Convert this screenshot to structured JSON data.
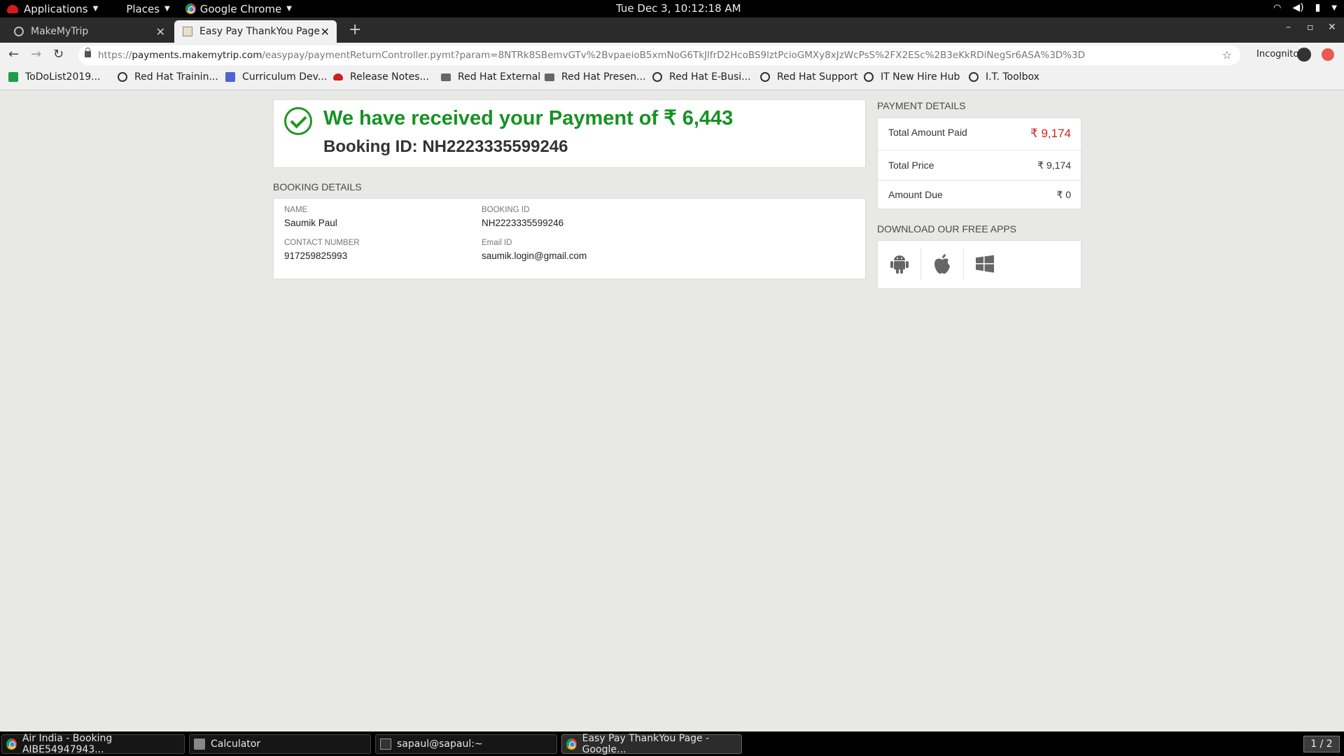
{
  "topbar": {
    "applications": "Applications",
    "places": "Places",
    "app": "Google Chrome",
    "clock": "Tue Dec  3, 10:12:18 AM",
    "tray": [
      "wifi-icon",
      "volume-icon",
      "battery-icon",
      "power-icon"
    ]
  },
  "tabs": [
    {
      "title": "MakeMyTrip",
      "icon": "globe-icon"
    },
    {
      "title": "Easy Pay ThankYou Page",
      "icon": "page-icon"
    }
  ],
  "omnibox": {
    "url_scheme": "https://",
    "url_host": "payments.makemytrip.com",
    "url_path": "/easypay/paymentReturnController.pymt?param=8NTRk8SBemvGTv%2BvpaeioB5xmNoG6TkJlfrD2HcoBS9lztPcioGMXy8xJzWcPsS%2FX2ESc%2B3eKkRDiNegSr6ASA%3D%3D"
  },
  "incognito_label": "Incognito",
  "bookmarks": [
    {
      "label": "ToDoList2019...",
      "icon": "green"
    },
    {
      "label": "Red Hat Trainin...",
      "icon": "globe"
    },
    {
      "label": "Curriculum Dev...",
      "icon": "doc"
    },
    {
      "label": "Release Notes...",
      "icon": "redhat"
    },
    {
      "label": "Red Hat External",
      "icon": "folder"
    },
    {
      "label": "Red Hat Presen...",
      "icon": "folder"
    },
    {
      "label": "Red Hat E-Busi...",
      "icon": "globe"
    },
    {
      "label": "Red Hat Support",
      "icon": "globe"
    },
    {
      "label": "IT New Hire Hub",
      "icon": "globe"
    },
    {
      "label": "I.T. Toolbox",
      "icon": "globe"
    }
  ],
  "payment": {
    "title": "We have received your Payment of ₹ 6,443",
    "booking_line": "Booking ID: NH2223335599246"
  },
  "booking_details": {
    "heading": "BOOKING DETAILS",
    "name_label": "NAME",
    "name_value": "Saumik Paul",
    "booking_id_label": "BOOKING ID",
    "booking_id_value": "NH2223335599246",
    "contact_label": "CONTACT NUMBER",
    "contact_value": "917259825993",
    "email_label": "Email ID",
    "email_value": "saumik.login@gmail.com"
  },
  "payment_details": {
    "heading": "PAYMENT DETAILS",
    "rows": [
      {
        "label": "Total Amount Paid",
        "value": "₹ 9,174"
      },
      {
        "label": "Total Price",
        "value": "₹ 9,174"
      },
      {
        "label": "Amount Due",
        "value": "₹ 0"
      }
    ]
  },
  "apps": {
    "heading": "DOWNLOAD OUR FREE APPS",
    "items": [
      "android-icon",
      "apple-icon",
      "windows-icon"
    ]
  },
  "taskbar": {
    "tasks": [
      {
        "label": "Air India - Booking AIBE54947943..."
      },
      {
        "label": "Calculator"
      },
      {
        "label": "sapaul@sapaul:~"
      },
      {
        "label": "Easy Pay ThankYou Page - Google..."
      }
    ],
    "workspace": "1 / 2"
  }
}
